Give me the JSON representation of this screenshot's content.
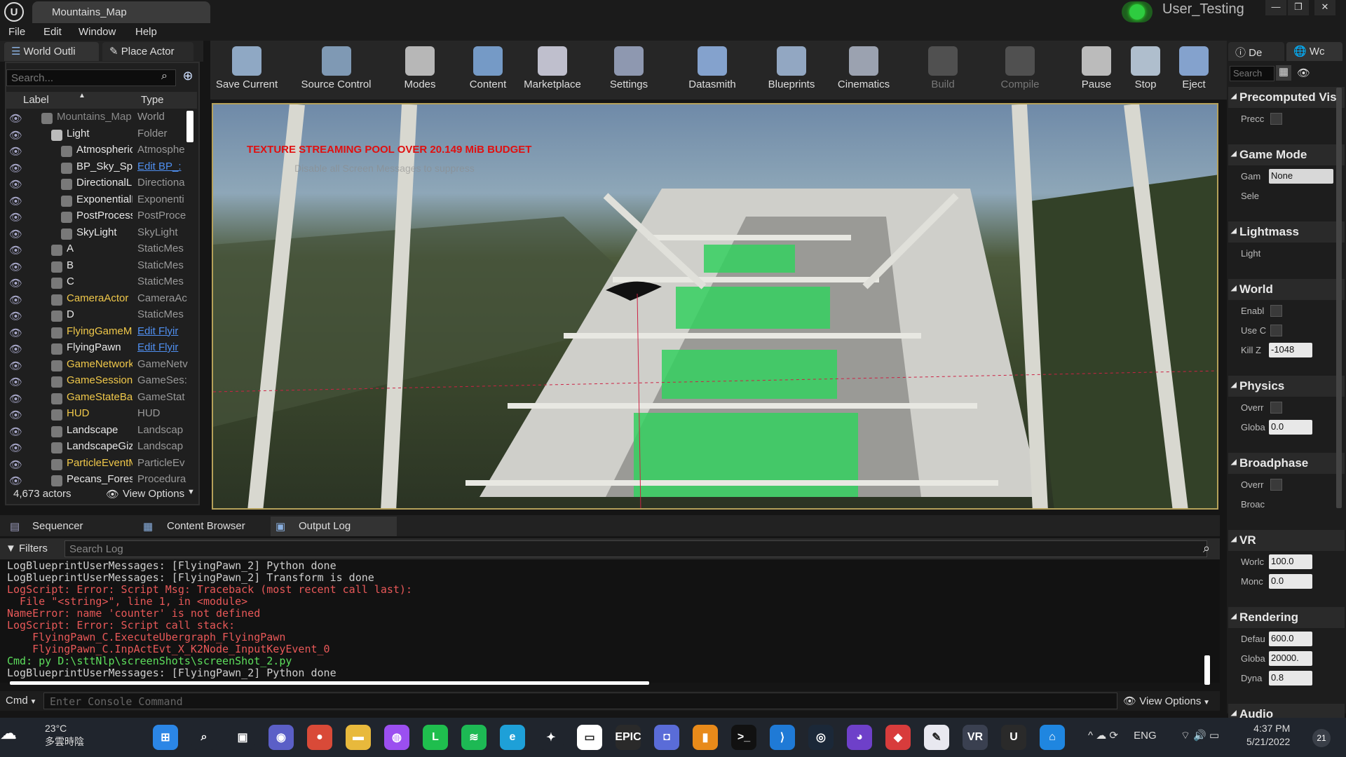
{
  "window": {
    "tab": "Mountains_Map",
    "user": "User_Testing",
    "min": "—",
    "max": "❐",
    "close": "✕"
  },
  "menu": [
    "File",
    "Edit",
    "Window",
    "Help"
  ],
  "outliner": {
    "tab": "World Outli",
    "place_tab": "Place Actor",
    "search_placeholder": "Search...",
    "col_label": "Label",
    "col_type": "Type",
    "rows": [
      {
        "label": "Mountains_Map",
        "type": "World",
        "link": false,
        "indent": 0,
        "dim": true
      },
      {
        "label": "Light",
        "type": "Folder",
        "link": false,
        "indent": 1
      },
      {
        "label": "Atmospheric",
        "type": "Atmosphe",
        "link": false,
        "indent": 2
      },
      {
        "label": "BP_Sky_Sph",
        "type": "Edit BP_:",
        "link": true,
        "indent": 2
      },
      {
        "label": "DirectionalLi",
        "type": "Directiona",
        "link": false,
        "indent": 2
      },
      {
        "label": "ExponentialH",
        "type": "Exponenti",
        "link": false,
        "indent": 2
      },
      {
        "label": "PostProcess",
        "type": "PostProce",
        "link": false,
        "indent": 2
      },
      {
        "label": "SkyLight",
        "type": "SkyLight",
        "link": false,
        "indent": 2
      },
      {
        "label": "A",
        "type": "StaticMes",
        "link": false,
        "indent": 1
      },
      {
        "label": "B",
        "type": "StaticMes",
        "link": false,
        "indent": 1
      },
      {
        "label": "C",
        "type": "StaticMes",
        "link": false,
        "indent": 1
      },
      {
        "label": "CameraActor",
        "type": "CameraAc",
        "link": false,
        "indent": 1,
        "yellow": true
      },
      {
        "label": "D",
        "type": "StaticMes",
        "link": false,
        "indent": 1
      },
      {
        "label": "FlyingGameMo",
        "type": "Edit Flyir",
        "link": true,
        "indent": 1,
        "yellow": true
      },
      {
        "label": "FlyingPawn",
        "type": "Edit Flyir",
        "link": true,
        "indent": 1
      },
      {
        "label": "GameNetworkM",
        "type": "GameNetv",
        "link": false,
        "indent": 1,
        "yellow": true
      },
      {
        "label": "GameSession",
        "type": "GameSes:",
        "link": false,
        "indent": 1,
        "yellow": true
      },
      {
        "label": "GameStateBas",
        "type": "GameStat",
        "link": false,
        "indent": 1,
        "yellow": true
      },
      {
        "label": "HUD",
        "type": "HUD",
        "link": false,
        "indent": 1,
        "yellow": true
      },
      {
        "label": "Landscape",
        "type": "Landscap",
        "link": false,
        "indent": 1
      },
      {
        "label": "LandscapeGizr",
        "type": "Landscap",
        "link": false,
        "indent": 1
      },
      {
        "label": "ParticleEventM",
        "type": "ParticleEv",
        "link": false,
        "indent": 1,
        "yellow": true
      },
      {
        "label": "Pecans_Forest",
        "type": "Procedura",
        "link": false,
        "indent": 1
      }
    ],
    "actor_count": "4,673 actors",
    "view_options": "View Options"
  },
  "toolbar": [
    {
      "label": "Save Current",
      "color": "#9bb7d6",
      "dim": false
    },
    {
      "label": "Source Control",
      "color": "#8aa6c4",
      "dim": false
    },
    {
      "label": "Modes",
      "color": "#c8c8c8",
      "dim": false
    },
    {
      "label": "Content",
      "color": "#7ea7d8",
      "dim": false
    },
    {
      "label": "Marketplace",
      "color": "#d0d0e0",
      "dim": false
    },
    {
      "label": "Settings",
      "color": "#9aa5c0",
      "dim": false
    },
    {
      "label": "Datasmith",
      "color": "#8fb0e0",
      "dim": false
    },
    {
      "label": "Blueprints",
      "color": "#9fb6d4",
      "dim": false
    },
    {
      "label": "Cinematics",
      "color": "#a8b0c0",
      "dim": false
    },
    {
      "label": "Build",
      "color": "#555555",
      "dim": true
    },
    {
      "label": "Compile",
      "color": "#555555",
      "dim": true
    },
    {
      "label": "Pause",
      "color": "#cccccc",
      "dim": false
    },
    {
      "label": "Stop",
      "color": "#bfcfe0",
      "dim": false
    },
    {
      "label": "Eject",
      "color": "#8fb0e0",
      "dim": false
    }
  ],
  "viewport": {
    "warning": "TEXTURE STREAMING POOL OVER 20.149 MiB BUDGET",
    "sub": "Disable all Screen Messages to suppress"
  },
  "bottom_tabs": [
    "Sequencer",
    "Content Browser",
    "Output Log"
  ],
  "log": {
    "filters": "Filters",
    "search_placeholder": "Search Log",
    "lines": [
      {
        "text": "LogBlueprintUserMessages: [FlyingPawn_2] Python done",
        "kind": "info"
      },
      {
        "text": "LogBlueprintUserMessages: [FlyingPawn_2] Transform is done",
        "kind": "info"
      },
      {
        "text": "LogScript: Error: Script Msg: Traceback (most recent call last):",
        "kind": "err"
      },
      {
        "text": "  File \"<string>\", line 1, in <module>",
        "kind": "err"
      },
      {
        "text": "NameError: name 'counter' is not defined",
        "kind": "err"
      },
      {
        "text": "LogScript: Error: Script call stack:",
        "kind": "err"
      },
      {
        "text": "    FlyingPawn_C.ExecuteUbergraph_FlyingPawn",
        "kind": "err"
      },
      {
        "text": "    FlyingPawn_C.InpActEvt_X_K2Node_InputKeyEvent_0",
        "kind": "err"
      },
      {
        "text": "Cmd: py D:\\sttNlp\\screenShots\\screenShot_2.py",
        "kind": "cmd"
      },
      {
        "text": "LogBlueprintUserMessages: [FlyingPawn_2] Python done",
        "kind": "info"
      }
    ],
    "cmd_label": "Cmd",
    "cmd_placeholder": "Enter Console Command",
    "view_options": "View Options"
  },
  "details": {
    "tab1": "De",
    "tab2": "Wc",
    "search": "Search",
    "sections": [
      {
        "title": "Precomputed Vis",
        "props": [
          {
            "label": "Precc",
            "kind": "cb"
          }
        ]
      },
      {
        "title": "Game Mode",
        "props": [
          {
            "label": "Gam",
            "kind": "val",
            "value": "None",
            "wide": true
          },
          {
            "label": "Sele",
            "kind": "none"
          }
        ]
      },
      {
        "title": "Lightmass",
        "props": [
          {
            "label": "Light",
            "kind": "none"
          }
        ]
      },
      {
        "title": "World",
        "props": [
          {
            "label": "Enabl",
            "kind": "cb"
          },
          {
            "label": "Use C",
            "kind": "cb"
          },
          {
            "label": "Kill Z",
            "kind": "val",
            "value": "-1048"
          }
        ]
      },
      {
        "title": "Physics",
        "props": [
          {
            "label": "Overr",
            "kind": "cb"
          },
          {
            "label": "Globa",
            "kind": "val",
            "value": "0.0"
          }
        ]
      },
      {
        "title": "Broadphase",
        "props": [
          {
            "label": "Overr",
            "kind": "cb"
          },
          {
            "label": "Broac",
            "kind": "none"
          }
        ]
      },
      {
        "title": "VR",
        "props": [
          {
            "label": "Worlc",
            "kind": "val",
            "value": "100.0"
          },
          {
            "label": "Monc",
            "kind": "val",
            "value": "0.0"
          }
        ]
      },
      {
        "title": "Rendering",
        "props": [
          {
            "label": "Defau",
            "kind": "val",
            "value": "600.0"
          },
          {
            "label": "Globa",
            "kind": "val",
            "value": "20000."
          },
          {
            "label": "Dyna",
            "kind": "val",
            "value": "0.8"
          }
        ]
      },
      {
        "title": "Audio",
        "props": []
      }
    ]
  },
  "taskbar": {
    "temp": "23°C",
    "weather": "多雲時陰",
    "lang": "ENG",
    "time": "4:37 PM",
    "date": "5/21/2022",
    "notif": "21",
    "icons": [
      {
        "name": "windows-start-icon",
        "color": "#2b86e6",
        "glyph": "⊞"
      },
      {
        "name": "search-icon",
        "color": "#20252d",
        "glyph": "⌕"
      },
      {
        "name": "task-view-icon",
        "color": "#20252d",
        "glyph": "▣"
      },
      {
        "name": "teams-icon",
        "color": "#5b5fc7",
        "glyph": "◉"
      },
      {
        "name": "chrome-icon",
        "color": "#d94a38",
        "glyph": "●"
      },
      {
        "name": "file-explorer-icon",
        "color": "#e8b93c",
        "glyph": "▬"
      },
      {
        "name": "messenger-icon",
        "color": "#9b4ff0",
        "glyph": "◍"
      },
      {
        "name": "line-icon",
        "color": "#1fbe4e",
        "glyph": "L"
      },
      {
        "name": "spotify-icon",
        "color": "#1db954",
        "glyph": "≋"
      },
      {
        "name": "edge-icon",
        "color": "#1ea0d8",
        "glyph": "e"
      },
      {
        "name": "inkscape-icon",
        "color": "#20252d",
        "glyph": "✦"
      },
      {
        "name": "roblox-icon",
        "color": "#ffffff",
        "glyph": "▭"
      },
      {
        "name": "epic-games-icon",
        "color": "#2a2a2a",
        "glyph": "EPIC"
      },
      {
        "name": "oculus-icon",
        "color": "#5a6cd8",
        "glyph": "◘"
      },
      {
        "name": "folder-icon",
        "color": "#e88a1a",
        "glyph": "▮"
      },
      {
        "name": "terminal-icon",
        "color": "#111111",
        "glyph": ">_"
      },
      {
        "name": "vscode-icon",
        "color": "#1f7ad6",
        "glyph": "⟩"
      },
      {
        "name": "steam-icon",
        "color": "#1b2838",
        "glyph": "◎"
      },
      {
        "name": "github-icon",
        "color": "#6e40c9",
        "glyph": "◕"
      },
      {
        "name": "game-icon",
        "color": "#d83c3c",
        "glyph": "◆"
      },
      {
        "name": "notepad-icon",
        "color": "#e8e8f0",
        "glyph": "✎"
      },
      {
        "name": "vr-icon",
        "color": "#3a4050",
        "glyph": "VR"
      },
      {
        "name": "unreal-engine-icon",
        "color": "#2a2a2a",
        "glyph": "U"
      },
      {
        "name": "home-icon",
        "color": "#1f86e0",
        "glyph": "⌂"
      }
    ]
  }
}
